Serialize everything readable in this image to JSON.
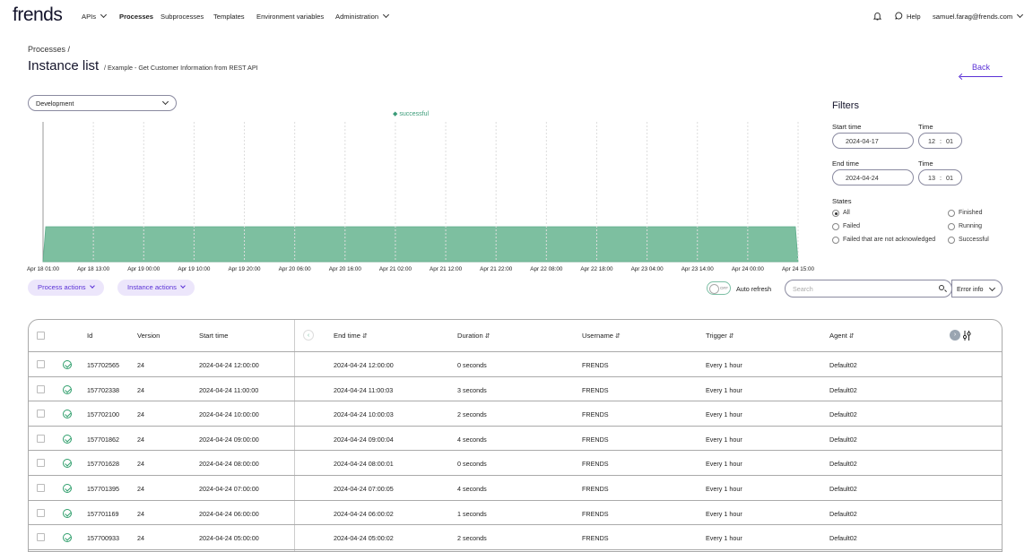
{
  "nav": {
    "logo": "frends",
    "items": [
      {
        "label": "APIs",
        "dropdown": true
      },
      {
        "label": "Processes",
        "active": true
      },
      {
        "label": "Subprocesses"
      },
      {
        "label": "Templates"
      },
      {
        "label": "Environment variables"
      },
      {
        "label": "Administration",
        "dropdown": true
      }
    ],
    "help": "Help",
    "user": "samuel.farag@frends.com"
  },
  "header": {
    "breadcrumb": "Processes /",
    "title": "Instance list",
    "subtitle": "/ Example - Get Customer Information from REST API",
    "back": "Back"
  },
  "environment": {
    "selected": "Development"
  },
  "chart_data": {
    "type": "area",
    "series": [
      {
        "name": "successful",
        "color": "#7dbfa0"
      }
    ],
    "x_ticks": [
      "Apr 18 01:00",
      "Apr 18 13:00",
      "Apr 19 00:00",
      "Apr 19 10:00",
      "Apr 19 20:00",
      "Apr 20 06:00",
      "Apr 20 16:00",
      "Apr 21 02:00",
      "Apr 21 12:00",
      "Apr 21 22:00",
      "Apr 22 08:00",
      "Apr 22 18:00",
      "Apr 23 04:00",
      "Apr 23 14:00",
      "Apr 24 00:00",
      "Apr 24 15:00"
    ],
    "values": [
      1,
      1,
      1,
      1,
      1,
      1,
      1,
      1,
      1,
      1,
      1,
      1,
      1,
      1,
      1,
      1
    ],
    "ylim": [
      0,
      4
    ],
    "grid": true,
    "legend": "top"
  },
  "filters": {
    "title": "Filters",
    "start_time_label": "Start time",
    "start_date": "2024-04-17",
    "time_label": "Time",
    "start_hour": "12",
    "start_min": "01",
    "end_time_label": "End time",
    "end_date": "2024-04-24",
    "end_hour": "13",
    "end_min": "01",
    "colon": ":",
    "states_label": "States",
    "states": [
      {
        "label": "All",
        "selected": true
      },
      {
        "label": "Finished"
      },
      {
        "label": "Failed"
      },
      {
        "label": "Running"
      },
      {
        "label": "Failed that are not acknowledged"
      },
      {
        "label": "Successful"
      }
    ]
  },
  "actions": {
    "process_actions": "Process actions",
    "instance_actions": "Instance actions",
    "toggle_state": "OFF",
    "auto_refresh": "Auto refresh",
    "search_placeholder": "Search",
    "error_info": "Error info"
  },
  "table": {
    "columns": [
      "Id",
      "Version",
      "Start time",
      "End time",
      "Duration",
      "Username",
      "Trigger",
      "Agent"
    ],
    "rows": [
      {
        "id": "157702565",
        "version": "24",
        "start": "2024-04-24 12:00:00",
        "end": "2024-04-24 12:00:00",
        "duration": "0 seconds",
        "username": "FRENDS",
        "trigger": "Every 1 hour",
        "agent": "Default02"
      },
      {
        "id": "157702338",
        "version": "24",
        "start": "2024-04-24 11:00:00",
        "end": "2024-04-24 11:00:03",
        "duration": "3 seconds",
        "username": "FRENDS",
        "trigger": "Every 1 hour",
        "agent": "Default02"
      },
      {
        "id": "157702100",
        "version": "24",
        "start": "2024-04-24 10:00:00",
        "end": "2024-04-24 10:00:03",
        "duration": "2 seconds",
        "username": "FRENDS",
        "trigger": "Every 1 hour",
        "agent": "Default02"
      },
      {
        "id": "157701862",
        "version": "24",
        "start": "2024-04-24 09:00:00",
        "end": "2024-04-24 09:00:04",
        "duration": "4 seconds",
        "username": "FRENDS",
        "trigger": "Every 1 hour",
        "agent": "Default02"
      },
      {
        "id": "157701628",
        "version": "24",
        "start": "2024-04-24 08:00:00",
        "end": "2024-04-24 08:00:01",
        "duration": "0 seconds",
        "username": "FRENDS",
        "trigger": "Every 1 hour",
        "agent": "Default02"
      },
      {
        "id": "157701395",
        "version": "24",
        "start": "2024-04-24 07:00:00",
        "end": "2024-04-24 07:00:05",
        "duration": "4 seconds",
        "username": "FRENDS",
        "trigger": "Every 1 hour",
        "agent": "Default02"
      },
      {
        "id": "157701169",
        "version": "24",
        "start": "2024-04-24 06:00:00",
        "end": "2024-04-24 06:00:02",
        "duration": "1 seconds",
        "username": "FRENDS",
        "trigger": "Every 1 hour",
        "agent": "Default02"
      },
      {
        "id": "157700933",
        "version": "24",
        "start": "2024-04-24 05:00:00",
        "end": "2024-04-24 05:00:02",
        "duration": "2 seconds",
        "username": "FRENDS",
        "trigger": "Every 1 hour",
        "agent": "Default02"
      }
    ]
  }
}
